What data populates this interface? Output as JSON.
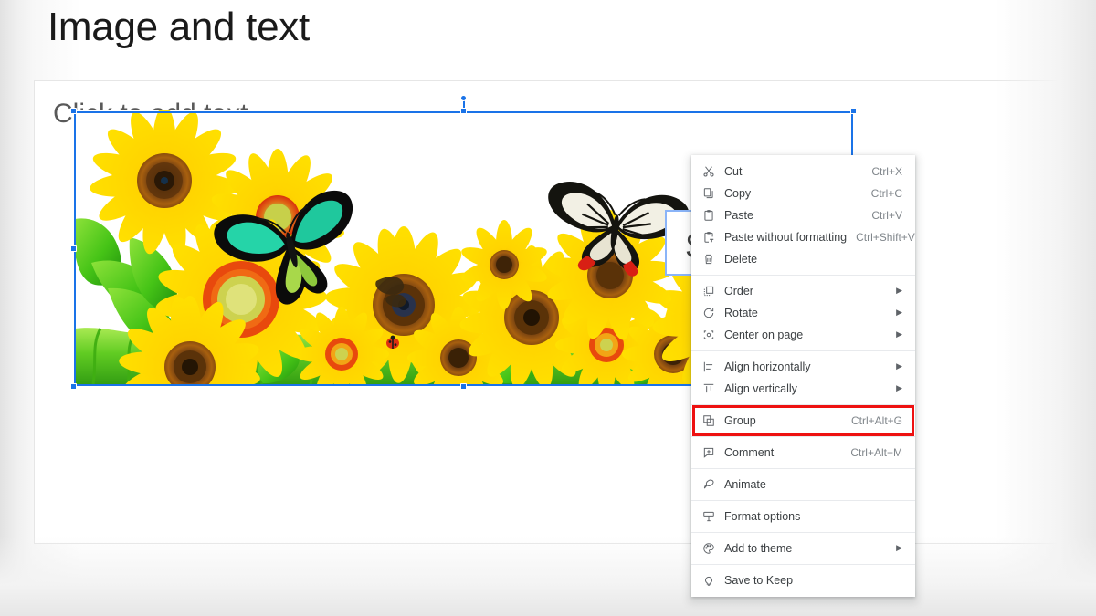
{
  "slide": {
    "title": "Image and text",
    "body_placeholder": "Click to add text",
    "text_box_value": "Sunflowers"
  },
  "image": {
    "alt": "sunflower-field-with-butterflies",
    "name": "sunflowers-image"
  },
  "selection": {
    "type": "multi-select",
    "handles": [
      "top-left",
      "top-center",
      "top-right",
      "middle-left",
      "middle-right",
      "bottom-left",
      "bottom-center",
      "bottom-right"
    ],
    "rotate_handle": "rotate-handle",
    "accent_color": "#1a73e8",
    "textbox_border_color": "#8ab4f8"
  },
  "highlight": {
    "target": "Group",
    "color": "#ee1111"
  },
  "context_menu": {
    "groups": [
      {
        "items": [
          {
            "icon": "cut-icon",
            "label": "Cut",
            "accel": "Ctrl+X",
            "submenu": false
          },
          {
            "icon": "copy-icon",
            "label": "Copy",
            "accel": "Ctrl+C",
            "submenu": false
          },
          {
            "icon": "paste-icon",
            "label": "Paste",
            "accel": "Ctrl+V",
            "submenu": false
          },
          {
            "icon": "paste-plain-icon",
            "label": "Paste without formatting",
            "accel": "Ctrl+Shift+V",
            "submenu": false
          },
          {
            "icon": "delete-icon",
            "label": "Delete",
            "accel": "",
            "submenu": false
          }
        ]
      },
      {
        "items": [
          {
            "icon": "order-icon",
            "label": "Order",
            "accel": "",
            "submenu": true
          },
          {
            "icon": "rotate-icon",
            "label": "Rotate",
            "accel": "",
            "submenu": true
          },
          {
            "icon": "center-icon",
            "label": "Center on page",
            "accel": "",
            "submenu": true
          }
        ]
      },
      {
        "items": [
          {
            "icon": "align-horizontal-icon",
            "label": "Align horizontally",
            "accel": "",
            "submenu": true
          },
          {
            "icon": "align-vertical-icon",
            "label": "Align vertically",
            "accel": "",
            "submenu": true
          }
        ]
      },
      {
        "items": [
          {
            "icon": "group-icon",
            "label": "Group",
            "accel": "Ctrl+Alt+G",
            "submenu": false
          }
        ]
      },
      {
        "items": [
          {
            "icon": "comment-icon",
            "label": "Comment",
            "accel": "Ctrl+Alt+M",
            "submenu": false
          }
        ]
      },
      {
        "items": [
          {
            "icon": "animate-icon",
            "label": "Animate",
            "accel": "",
            "submenu": false
          }
        ]
      },
      {
        "items": [
          {
            "icon": "format-options-icon",
            "label": "Format options",
            "accel": "",
            "submenu": false
          }
        ]
      },
      {
        "items": [
          {
            "icon": "palette-icon",
            "label": "Add to theme",
            "accel": "",
            "submenu": true
          }
        ]
      },
      {
        "items": [
          {
            "icon": "keep-bulb-icon",
            "label": "Save to Keep",
            "accel": "",
            "submenu": false
          }
        ]
      }
    ]
  }
}
